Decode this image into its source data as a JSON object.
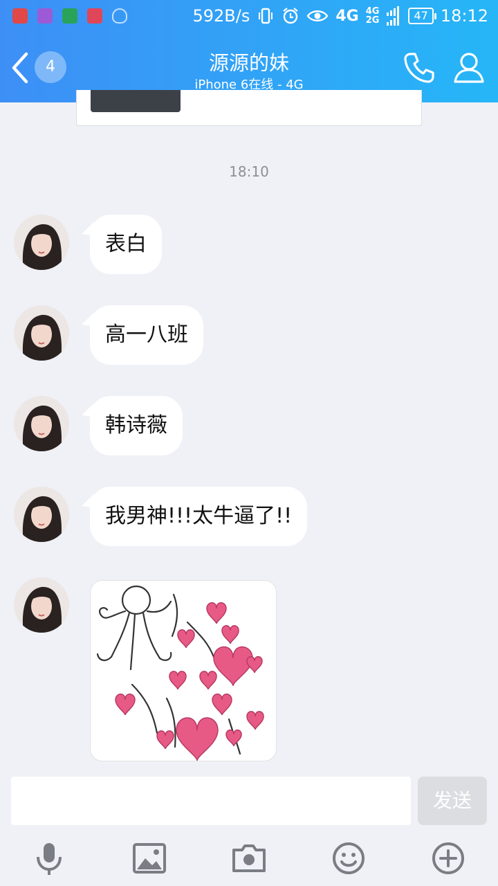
{
  "status_bar": {
    "network_speed": "592B/s",
    "network_type": "4G",
    "secondary_networks": [
      "4G",
      "2G"
    ],
    "battery": "47",
    "time": "18:12",
    "notification_icons": [
      "weibo-icon",
      "photo-icon",
      "wechat-icon",
      "cloud-icon",
      "shield-icon"
    ]
  },
  "header": {
    "unread_count": "4",
    "title": "源源的妹",
    "subtitle": "iPhone 6在线 - 4G"
  },
  "chat": {
    "timestamp": "18:10",
    "messages": [
      {
        "type": "text",
        "text": "表白"
      },
      {
        "type": "text",
        "text": "高一八班"
      },
      {
        "type": "text",
        "text": "韩诗薇"
      },
      {
        "type": "text",
        "text": "我男神!!!太牛逼了!!"
      },
      {
        "type": "sticker",
        "description": "hearts-sticker"
      }
    ]
  },
  "composer": {
    "input_value": "",
    "send_label": "发送"
  },
  "toolbar_icons": [
    "microphone-icon",
    "image-icon",
    "camera-icon",
    "emoji-icon",
    "plus-icon"
  ],
  "colors": {
    "header_start": "#3d8ff6",
    "header_end": "#26b6f7",
    "background": "#f0f1f6",
    "icon_gray": "#7b7d85",
    "heart_pink": "#e85a86"
  }
}
